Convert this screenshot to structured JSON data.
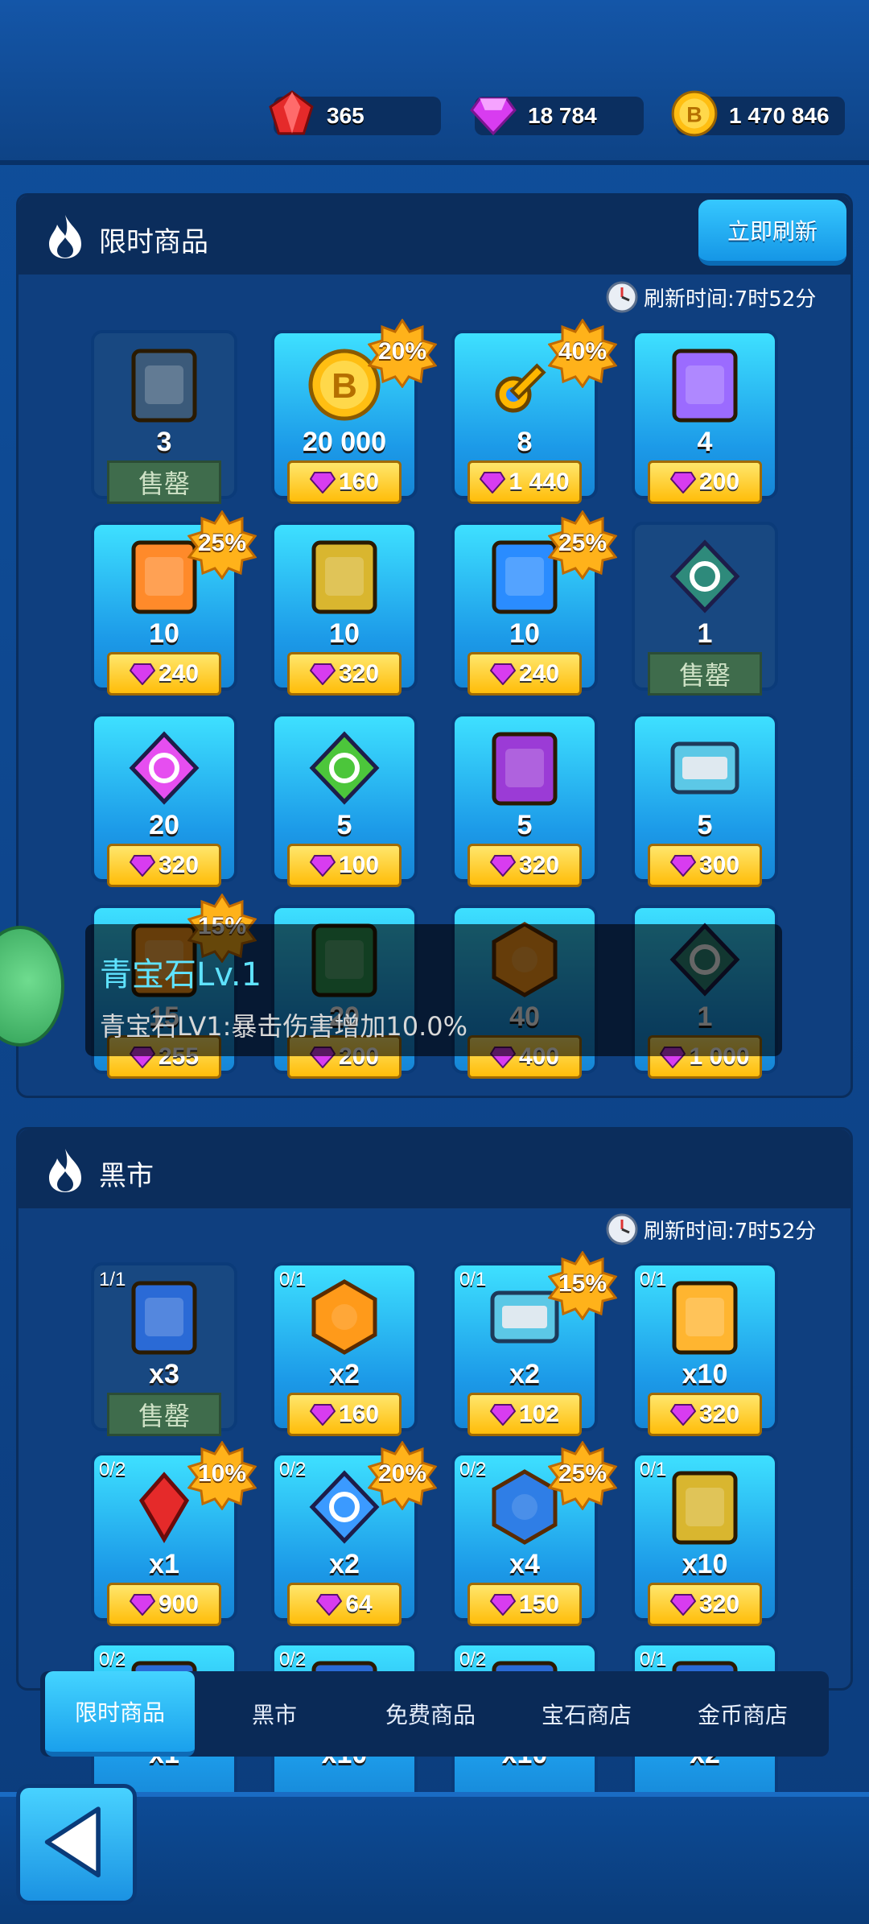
{
  "currencies": [
    {
      "name": "ruby",
      "value": "365"
    },
    {
      "name": "gem",
      "value": "18 784"
    },
    {
      "name": "coin",
      "value": "1 470 846"
    }
  ],
  "limited": {
    "title": "限时商品",
    "refresh_button": "立即刷新",
    "refresh_time": "刷新时间:7时52分",
    "items": [
      {
        "icon": "turret-part-icon",
        "qty": "3",
        "sold": true,
        "sold_label": "售罄"
      },
      {
        "icon": "coin-icon",
        "qty": "20 000",
        "price": "160",
        "discount": "20%"
      },
      {
        "icon": "key-icon",
        "qty": "8",
        "price": "1 440",
        "discount": "40%"
      },
      {
        "icon": "cube-card-icon",
        "qty": "4",
        "price": "200"
      },
      {
        "icon": "tower-card-icon",
        "qty": "10",
        "price": "240",
        "discount": "25%"
      },
      {
        "icon": "gun-card-icon",
        "qty": "10",
        "price": "320"
      },
      {
        "icon": "skill-card-icon",
        "qty": "10",
        "price": "240",
        "discount": "25%"
      },
      {
        "icon": "diamond-icon",
        "qty": "1",
        "sold": true,
        "sold_label": "售罄"
      },
      {
        "icon": "pink-gem-icon",
        "qty": "20",
        "price": "320"
      },
      {
        "icon": "green-gem-icon",
        "qty": "5",
        "price": "100"
      },
      {
        "icon": "purple-robot-card-icon",
        "qty": "5",
        "price": "320"
      },
      {
        "icon": "chest-icon",
        "qty": "5",
        "price": "300"
      },
      {
        "icon": "orange-item-icon",
        "qty": "15",
        "price": "255",
        "discount": "15%"
      },
      {
        "icon": "hero-icon",
        "qty": "20",
        "price": "200"
      },
      {
        "icon": "hex-badge-icon",
        "qty": "40",
        "price": "400"
      },
      {
        "icon": "diamond-icon",
        "qty": "1",
        "price": "1 000"
      }
    ]
  },
  "tooltip": {
    "title": "青宝石Lv.1",
    "desc": "青宝石LV1:暴击伤害增加10.0%"
  },
  "blackmarket": {
    "title": "黑市",
    "refresh_time": "刷新时间:7时52分",
    "items": [
      {
        "icon": "time-card-icon",
        "stock": "1/1",
        "qty": "x3",
        "sold": true,
        "sold_label": "售罄"
      },
      {
        "icon": "star-badge-icon",
        "stock": "0/1",
        "qty": "x2",
        "price": "160"
      },
      {
        "icon": "chest-icon",
        "stock": "0/1",
        "qty": "x2",
        "price": "102",
        "discount": "15%"
      },
      {
        "icon": "helmet-card-icon",
        "stock": "0/1",
        "qty": "x10",
        "price": "320"
      },
      {
        "icon": "ruby-icon",
        "stock": "0/2",
        "qty": "x1",
        "price": "900",
        "discount": "10%"
      },
      {
        "icon": "blue-gem-icon",
        "stock": "0/2",
        "qty": "x2",
        "price": "64",
        "discount": "20%"
      },
      {
        "icon": "blue-hex-icon",
        "stock": "0/2",
        "qty": "x4",
        "price": "150",
        "discount": "25%"
      },
      {
        "icon": "gun-card-icon",
        "stock": "0/1",
        "qty": "x10",
        "price": "320"
      },
      {
        "icon": "item-icon",
        "stock": "0/2",
        "qty": "x1"
      },
      {
        "icon": "item-icon",
        "stock": "0/2",
        "qty": "x10"
      },
      {
        "icon": "item-icon",
        "stock": "0/2",
        "qty": "x10"
      },
      {
        "icon": "item-icon",
        "stock": "0/1",
        "qty": "x2"
      }
    ]
  },
  "tabs": [
    {
      "label": "限时商品",
      "active": true
    },
    {
      "label": "黑市"
    },
    {
      "label": "免费商品"
    },
    {
      "label": "宝石商店"
    },
    {
      "label": "金币商店"
    }
  ],
  "colors": {
    "price_gold": "#ffc21a",
    "card_blue": "#27b7f2",
    "accent": "#36c8ff",
    "gem_pink": "#d83cf0"
  }
}
